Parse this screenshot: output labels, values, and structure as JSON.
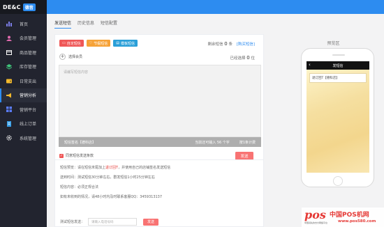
{
  "brand": {
    "name": "DE&C",
    "badge": "德音"
  },
  "sidebar": {
    "items": [
      {
        "label": "首页",
        "icon": "chart-bar-icon"
      },
      {
        "label": "会员管理",
        "icon": "users-icon"
      },
      {
        "label": "商品管理",
        "icon": "box-icon"
      },
      {
        "label": "库存管理",
        "icon": "layers-icon"
      },
      {
        "label": "日常支出",
        "icon": "wallet-icon"
      },
      {
        "label": "营销分析",
        "icon": "megaphone-icon"
      },
      {
        "label": "营销平台",
        "icon": "grid-icon"
      },
      {
        "label": "线上订单",
        "icon": "order-icon"
      },
      {
        "label": "系统管理",
        "icon": "gear-icon"
      }
    ],
    "active_index": 5
  },
  "tabs": [
    {
      "label": "发送短信"
    },
    {
      "label": "历史信息"
    },
    {
      "label": "短信配置"
    }
  ],
  "compose": {
    "btn_new": "自定短信",
    "btn_holiday": "节假短信",
    "btn_template": "模板短信",
    "remain_prefix": "剩余短信",
    "remain_count": "0",
    "remain_unit": "条",
    "buy_label": "[购买短信]",
    "select_contacts": "选择会员",
    "selected_prefix": "已经选择",
    "selected_count": "0",
    "selected_unit": "位",
    "placeholder": "请编写短信内容",
    "signature": "短信签名【德科店】",
    "stat": "当前还可输入 56 个字",
    "stat2": "按1条计费",
    "agree_label": "同意短信发送条款",
    "send_label": "发送"
  },
  "notes": {
    "line1_prefix": "短信预览：请在短信末尾加上",
    "line1_red": "退订回T",
    "line1_suffix": "，并使用自己的店铺签名发送短信",
    "line2": "送到时间：测试短信30分钟左右，群发短信1小时25分钟左右",
    "line3": "短信内容：必须正规合法",
    "line4": "如有未收到的情况，请48小时内及时联系客服QQ：3459313137",
    "test_label": "测试短信发送：",
    "test_placeholder": "请输入电话号码",
    "test_button": "发送"
  },
  "preview": {
    "title": "预览区",
    "screen_title": "发短信",
    "bubble_text": "退订回T【德科店】"
  },
  "watermark": {
    "logo": "pos",
    "cn": "中国POS机网",
    "url": "www.pos580.com",
    "slogan": "中国领先的支付网络平台"
  }
}
